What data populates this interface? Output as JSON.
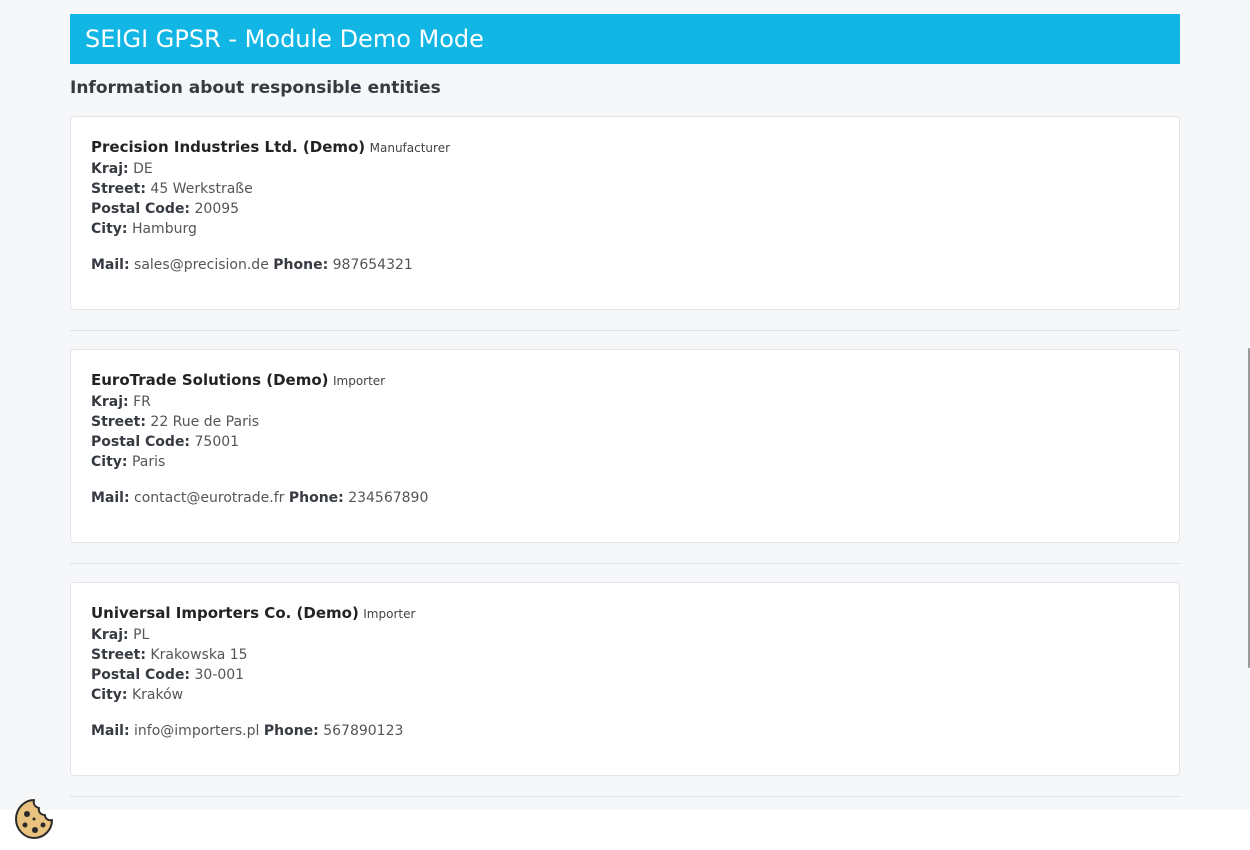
{
  "banner": {
    "title": "SEIGI GPSR - Module Demo Mode"
  },
  "section": {
    "title": "Information about responsible entities"
  },
  "labels": {
    "country": "Kraj:",
    "street": "Street:",
    "postal": "Postal Code:",
    "city": "City:",
    "mail": "Mail:",
    "phone": "Phone:"
  },
  "entities": [
    {
      "name": "Precision Industries Ltd. (Demo)",
      "role": "Manufacturer",
      "country": "DE",
      "street": "45 Werkstraße",
      "postal": "20095",
      "city": "Hamburg",
      "mail": "sales@precision.de",
      "phone": "987654321"
    },
    {
      "name": "EuroTrade Solutions (Demo)",
      "role": "Importer",
      "country": "FR",
      "street": "22 Rue de Paris",
      "postal": "75001",
      "city": "Paris",
      "mail": "contact@eurotrade.fr",
      "phone": "234567890"
    },
    {
      "name": "Universal Importers Co. (Demo)",
      "role": "Importer",
      "country": "PL",
      "street": "Krakowska 15",
      "postal": "30-001",
      "city": "Kraków",
      "mail": "info@importers.pl",
      "phone": "567890123"
    }
  ],
  "colors": {
    "banner": "#11b6e4",
    "cookie": "#e8c27e"
  },
  "icons": {
    "cookie": "cookie-icon"
  }
}
